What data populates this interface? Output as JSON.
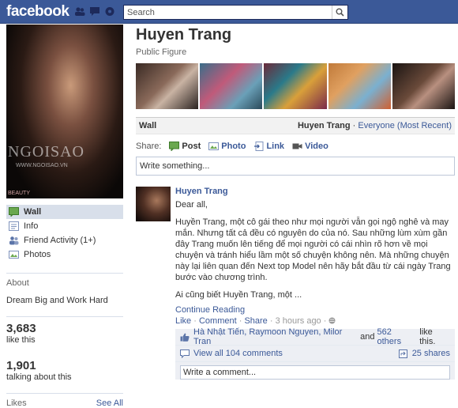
{
  "header": {
    "logo": "facebook",
    "search_placeholder": "Search"
  },
  "profile": {
    "picture_watermark": "NGOISAO",
    "picture_url": "WWW.NGOISAO.VN",
    "picture_brand": "BEAUTY",
    "name": "Huyen Trang",
    "category": "Public Figure"
  },
  "sidebar": {
    "nav": [
      {
        "label": "Wall",
        "icon": "wall-icon"
      },
      {
        "label": "Info",
        "icon": "info-icon"
      },
      {
        "label": "Friend Activity (1+)",
        "icon": "friend-activity-icon"
      },
      {
        "label": "Photos",
        "icon": "photos-icon"
      }
    ],
    "about_title": "About",
    "about_text": "Dream Big and Work Hard",
    "likes_count": "3,683",
    "likes_label": "like this",
    "talking_count": "1,901",
    "talking_label": "talking about this",
    "likes_section_title": "Likes",
    "see_all": "See All"
  },
  "wall": {
    "title": "Wall",
    "owner": "Huyen Trang",
    "separator": "·",
    "filter": "Everyone (Most Recent)",
    "share_label": "Share:",
    "share_options": [
      {
        "label": "Post",
        "icon": "status-icon"
      },
      {
        "label": "Photo",
        "icon": "photo-icon"
      },
      {
        "label": "Link",
        "icon": "link-icon"
      },
      {
        "label": "Video",
        "icon": "video-icon"
      }
    ],
    "composer_placeholder": "Write something..."
  },
  "story": {
    "author": "Huyen Trang",
    "greeting": "Dear all,",
    "paragraph": "Huyền Trang, một cô gái theo như mọi người vẫn gọi ngộ nghê và may mắn. Nhưng tất cả đều có nguyên do của nó. Sau những lùm xùm gần đây Trang muốn lên tiếng để mọi người có cái nhìn rõ hơn về mọi chuyện và tránh hiểu lầm một số chuyện không nên. Mà những chuyện này lại liên quan đến Next top Model nên hãy bắt đầu từ cái ngày Trang bước vào chương trình.",
    "teaser": "Ai cũng biết Huyền Trang, một ...",
    "continue": "Continue Reading",
    "actions": {
      "like": "Like",
      "comment": "Comment",
      "share": "Share",
      "time": "3 hours ago"
    },
    "likes_text_people": "Hà Nhật Tiến, Raymoon Nguyen, Milor Tran",
    "likes_text_and": "and",
    "likes_text_others": "562 others",
    "likes_text_suffix": "like this.",
    "view_comments": "View all 104 comments",
    "shares": "25 shares",
    "comment_placeholder": "Write a comment..."
  }
}
